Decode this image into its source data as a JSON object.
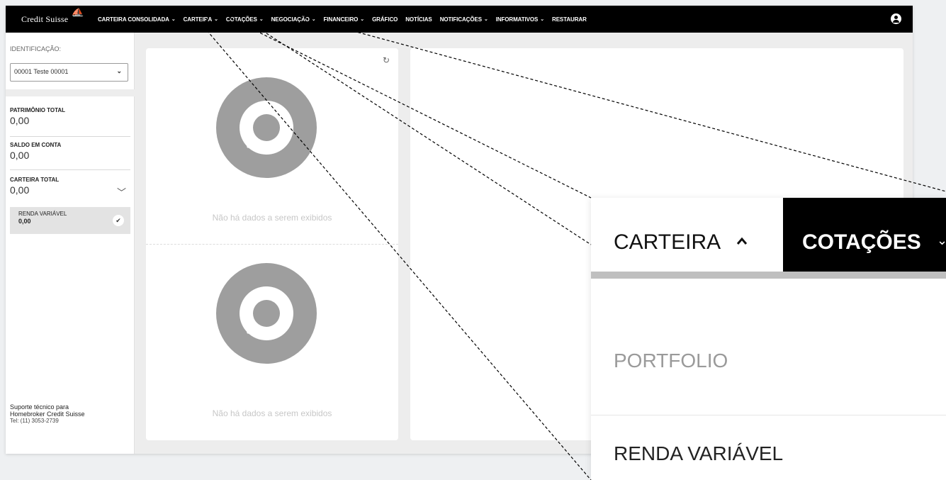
{
  "brand": {
    "name": "Credit Suisse"
  },
  "nav": {
    "items": [
      {
        "label": "CARTEIRA CONSOLIDADA",
        "has_dropdown": true
      },
      {
        "label": "CARTEIRA",
        "has_dropdown": true
      },
      {
        "label": "COTAÇÕES",
        "has_dropdown": true
      },
      {
        "label": "NEGOCIAÇÃO",
        "has_dropdown": true
      },
      {
        "label": "FINANCEIRO",
        "has_dropdown": true
      },
      {
        "label": "GRÁFICO",
        "has_dropdown": false
      },
      {
        "label": "NOTÍCIAS",
        "has_dropdown": false
      },
      {
        "label": "NOTIFICAÇÕES",
        "has_dropdown": true
      },
      {
        "label": "INFORMATIVOS",
        "has_dropdown": true
      },
      {
        "label": "RESTAURAR",
        "has_dropdown": false
      }
    ],
    "user_icon": "user-circle-icon"
  },
  "sidebar": {
    "id_label": "IDENTIFICAÇÃO:",
    "id_selected": "00001 Teste 00001",
    "metrics": {
      "patrimonio": {
        "label": "PATRIMÔNIO TOTAL",
        "value": "0,00"
      },
      "saldo": {
        "label": "SALDO EM CONTA",
        "value": "0,00"
      },
      "carteira": {
        "label": "CARTEIRA TOTAL",
        "value": "0,00"
      }
    },
    "renda_variavel": {
      "label": "RENDA VARIÁVEL",
      "value": "0,00"
    },
    "support": {
      "line1": "Suporte técnico para",
      "line2": "Homebroker Credit Suisse",
      "phone": "Tel: (11) 3053-2739"
    }
  },
  "main": {
    "no_data_top": "Não há dados a serem exibidos",
    "no_data_bottom": "Não há dados a serem exibidos"
  },
  "zoom": {
    "active_tab": "CARTEIRA",
    "next_tab": "COTAÇÕES",
    "menu": [
      {
        "label": "PORTFOLIO",
        "state": "disabled"
      },
      {
        "label": "RENDA VARIÁVEL",
        "state": "enabled"
      }
    ]
  },
  "colors": {
    "navbar": "#000000",
    "donut": "#9e9e9e",
    "nodata_text": "#c7c7c7",
    "callout_line": "#000000"
  }
}
